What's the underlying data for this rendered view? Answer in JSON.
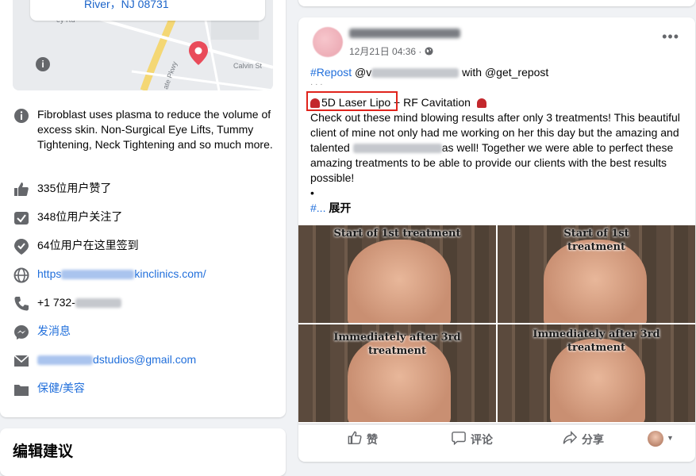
{
  "left": {
    "map": {
      "address_line": "River，NJ 08731",
      "streets": [
        "ey Rd",
        "ate Pkwy",
        "Calvin St"
      ]
    },
    "about": "Fibroblast uses plasma to reduce the volume of excess skin. Non-Surgical Eye Lifts, Tummy Tightening, Neck Tightening and so much more.",
    "likes": "335位用户赞了",
    "follows": "348位用户关注了",
    "checkins": "64位用户在这里签到",
    "website": {
      "prefix": "https",
      "suffix": "kinclinics.com/"
    },
    "phone": {
      "prefix": "+1 732-"
    },
    "message": "发消息",
    "email": {
      "suffix": "dstudios@gmail.com"
    },
    "category": "保健/美容",
    "edit_title": "编辑建议"
  },
  "post": {
    "time": "12月21日 04:36 ·",
    "more_icon": "more-icon",
    "line1_hashtag": "#Repost",
    "line1_mid": " @v",
    "line1_end": " with @get_repost",
    "line2": "· · ·",
    "line3_boxed": "5D Laser Lipo",
    "line3_rest": " + RF Cavitation",
    "body_a": "Check out these mind blowing results after only 3 treatments! This beautiful client of mine not only had me working on her this day but the amazing and talented",
    "body_b": "as well! Together we were able to perfect these amazing treatments to be able to provide our clients with the best results possible!",
    "bullet": "•",
    "more_hashtag": "#...",
    "expand": "展开",
    "photos": [
      {
        "caption": "Start of 1st treatment"
      },
      {
        "caption": "Start of 1st treatment"
      },
      {
        "caption": "Immediately after 3rd treatment"
      },
      {
        "caption": "Immediately after 3rd treatment"
      }
    ],
    "actions": {
      "like": "赞",
      "comment": "评论",
      "share": "分享"
    }
  },
  "colors": {
    "link": "#216fdb",
    "highlight": "#e0241c",
    "bg": "#f0f2f5"
  }
}
